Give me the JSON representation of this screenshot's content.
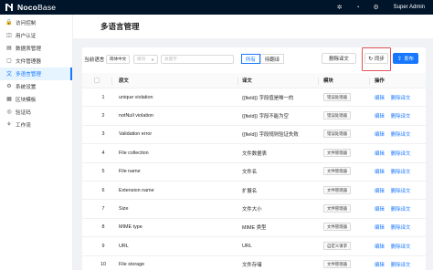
{
  "app": {
    "logo_bold": "Noco",
    "logo_light": "Base",
    "user": "Super Admin",
    "top_icons": [
      "bug-icon",
      "bell-icon",
      "settings-icon"
    ]
  },
  "sidebar": {
    "items": [
      {
        "label": "访问控制",
        "icon": "lock-icon",
        "glyph": "🔒"
      },
      {
        "label": "用户认证",
        "icon": "user-auth-icon",
        "glyph": "◫"
      },
      {
        "label": "数据表管理",
        "icon": "database-icon",
        "glyph": "▤"
      },
      {
        "label": "文件管理器",
        "icon": "file-icon",
        "glyph": "▢"
      },
      {
        "label": "多语言管理",
        "icon": "translation-icon",
        "glyph": "文",
        "active": true
      },
      {
        "label": "系统设置",
        "icon": "gear-icon",
        "glyph": "⚙"
      },
      {
        "label": "区块模板",
        "icon": "layout-icon",
        "glyph": "▦"
      },
      {
        "label": "验证码",
        "icon": "message-icon",
        "glyph": "◎"
      },
      {
        "label": "工作流",
        "icon": "workflow-icon",
        "glyph": "⚘"
      }
    ]
  },
  "page": {
    "title": "多语言管理"
  },
  "toolbar": {
    "lang_label": "当前语言",
    "lang_value": "简体中文",
    "module_placeholder": "模块",
    "search_placeholder": "关键字",
    "filter": [
      "所有",
      "待翻译"
    ],
    "delete_label": "删除译文",
    "sync_label": "同步",
    "publish_label": "发布"
  },
  "table": {
    "headers": {
      "source": "原文",
      "translation": "译文",
      "module": "模块",
      "actions": "操作"
    },
    "rows": [
      {
        "no": "1",
        "source": "unique violation",
        "translation": "{{field}} 字段值是唯一的",
        "module": "错误处理器"
      },
      {
        "no": "2",
        "source": "notNull violation",
        "translation": "{{field}} 字段不能为空",
        "module": "错误处理器"
      },
      {
        "no": "3",
        "source": "Validation error",
        "translation": "{{field}} 字段规则验证失败",
        "module": "错误处理器"
      },
      {
        "no": "4",
        "source": "File collection",
        "translation": "文件数据表",
        "module": "文件管理器"
      },
      {
        "no": "5",
        "source": "File name",
        "translation": "文件名",
        "module": "文件管理器"
      },
      {
        "no": "6",
        "source": "Extension name",
        "translation": "扩展名",
        "module": "文件管理器"
      },
      {
        "no": "7",
        "source": "Size",
        "translation": "文件大小",
        "module": "文件管理器"
      },
      {
        "no": "8",
        "source": "MIME type",
        "translation": "MIME 类型",
        "module": "文件管理器"
      },
      {
        "no": "9",
        "source": "URL",
        "translation": "URL",
        "module": "自定义请求"
      },
      {
        "no": "10",
        "source": "File storage",
        "translation": "文件存储",
        "module": "文件管理器"
      }
    ],
    "edit_label": "编辑",
    "delete_label": "删除译文"
  }
}
